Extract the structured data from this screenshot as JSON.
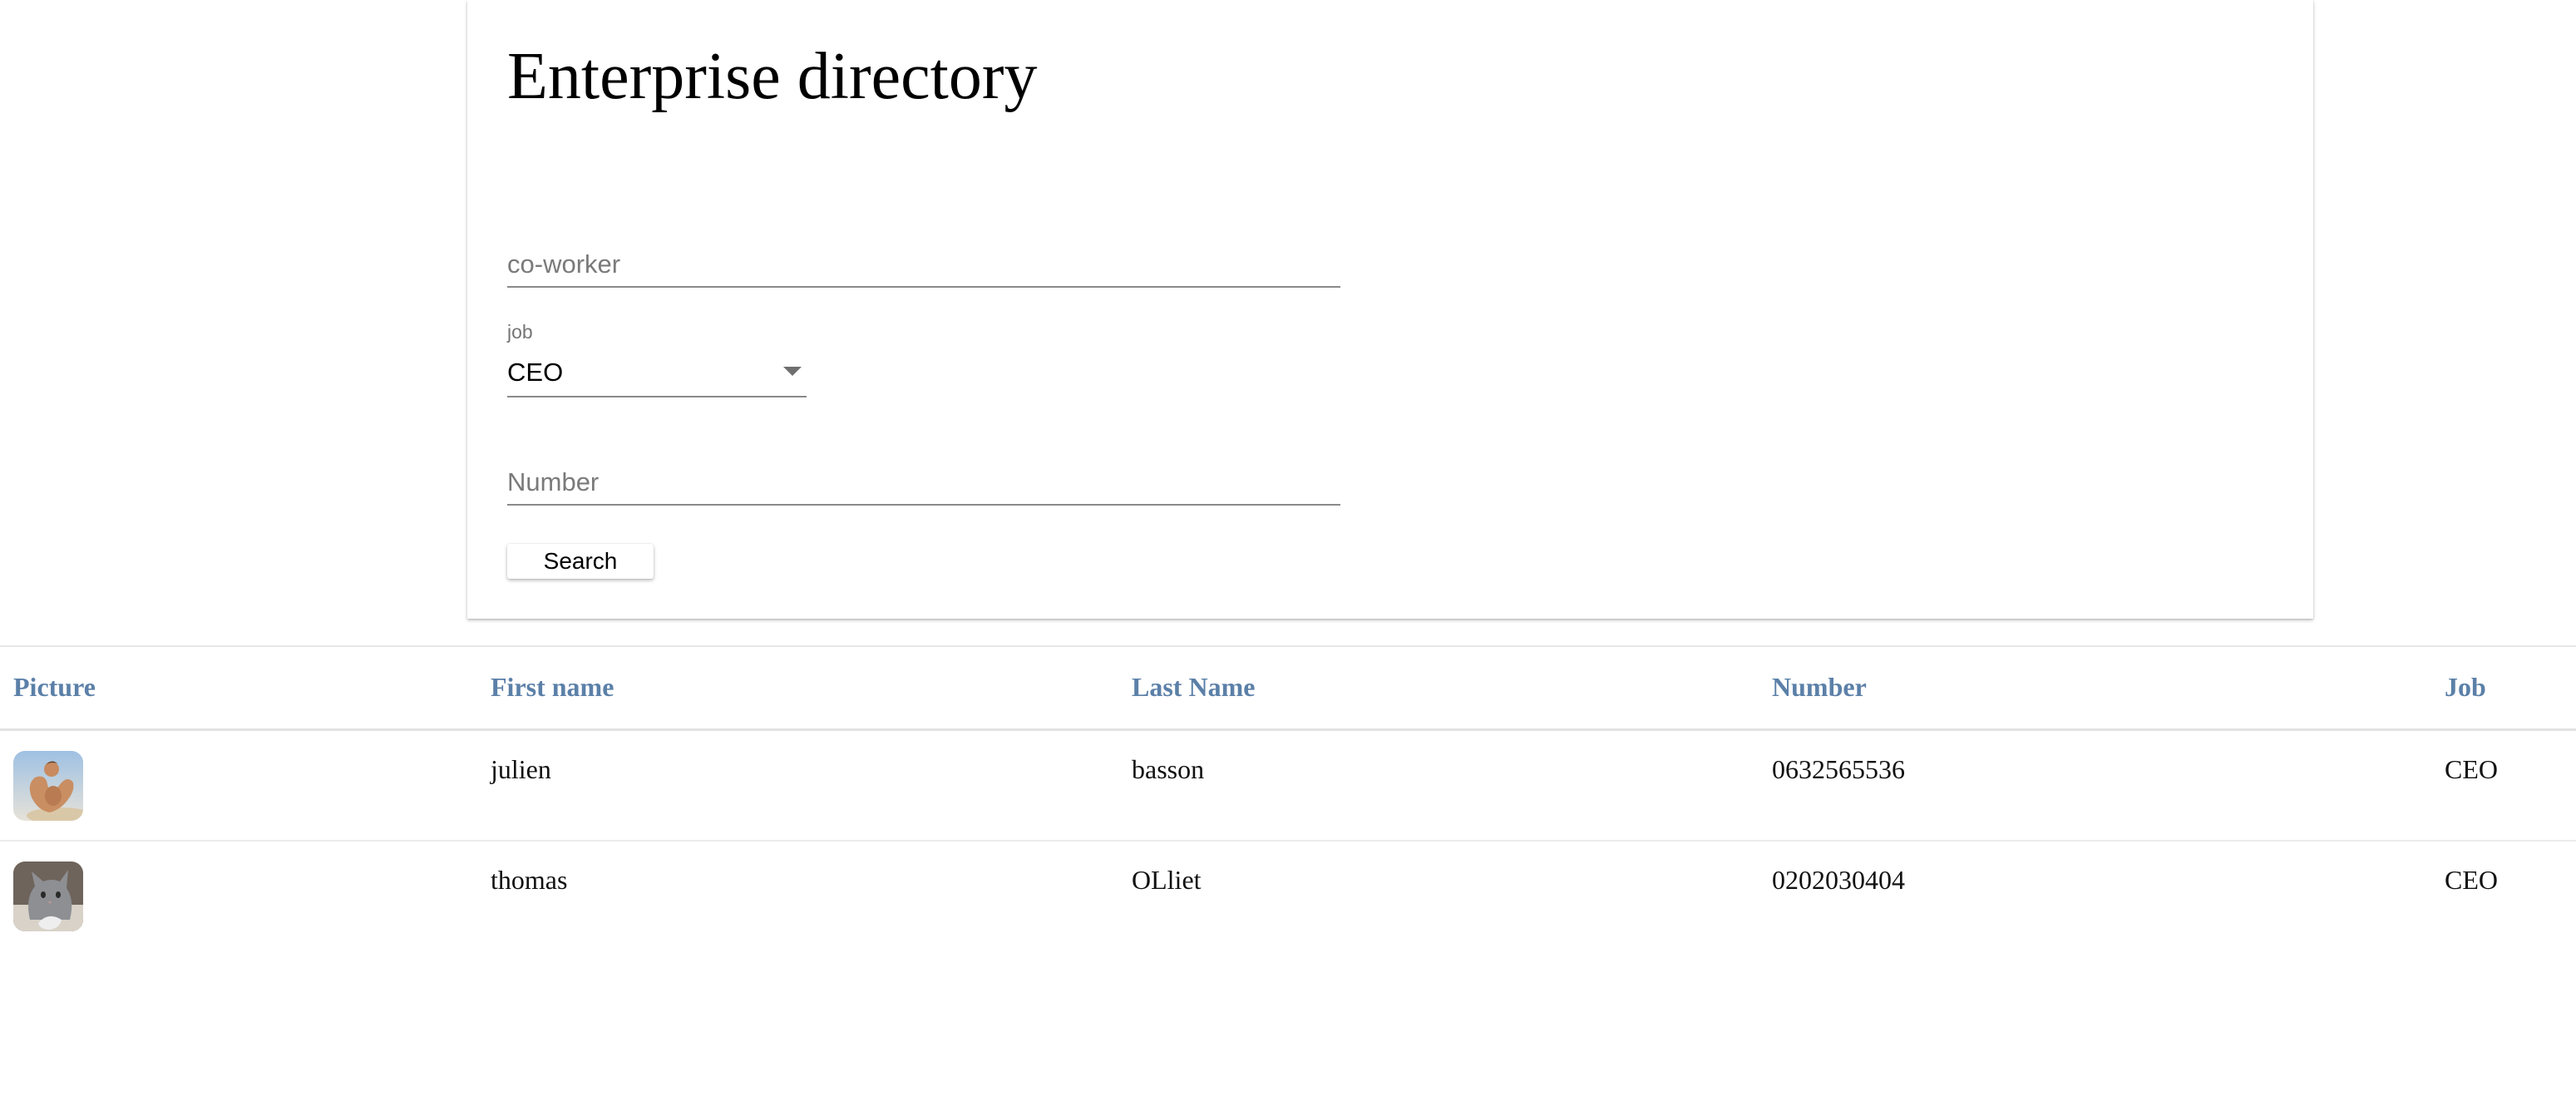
{
  "header": {
    "title": "Enterprise directory"
  },
  "form": {
    "coworker_placeholder": "co-worker",
    "coworker_value": "",
    "job_label": "job",
    "job_selected": "CEO",
    "number_placeholder": "Number",
    "number_value": "",
    "search_label": "Search"
  },
  "table": {
    "columns": [
      "Picture",
      "First name",
      "Last Name",
      "Number",
      "Job"
    ],
    "rows": [
      {
        "picture": "avatar-muscular-man-icon",
        "first_name": "julien",
        "last_name": "basson",
        "number": "0632565536",
        "job": "CEO"
      },
      {
        "picture": "avatar-cat-icon",
        "first_name": "thomas",
        "last_name": "OLliet",
        "number": "0202030404",
        "job": "CEO"
      }
    ]
  },
  "colors": {
    "header_text": "#5b80a8",
    "divider": "#e2e2e2",
    "underline": "#8a8a8a"
  }
}
